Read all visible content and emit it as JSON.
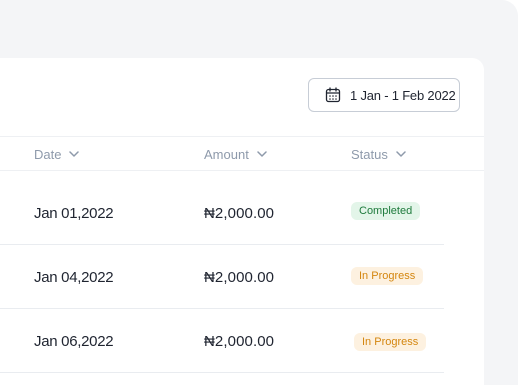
{
  "toolbar": {
    "date_range_label": "1 Jan - 1 Feb 2022",
    "date_range_icon": "calendar-icon"
  },
  "table": {
    "columns": [
      {
        "label": "Date",
        "icon": "chevron-down-icon"
      },
      {
        "label": "Amount",
        "icon": "chevron-down-icon"
      },
      {
        "label": "Status",
        "icon": "chevron-down-icon"
      }
    ],
    "rows": [
      {
        "date": "Jan 01,2022",
        "amount": "₦2,000.00",
        "status": "Completed"
      },
      {
        "date": "Jan 04,2022",
        "amount": "₦2,000.00",
        "status": "In Progress"
      },
      {
        "date": "Jan 06,2022",
        "amount": "₦2,000.00",
        "status": "In Progress"
      }
    ]
  },
  "colors": {
    "completed_bg": "#e3f5e9",
    "completed_text": "#1e7a3c",
    "in_progress_bg": "#fdf1e0",
    "in_progress_text": "#d4860f"
  }
}
